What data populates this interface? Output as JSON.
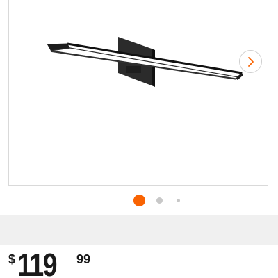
{
  "gallery": {
    "product_image_icon": "vanity-light-bar-image",
    "next_icon": "chevron-right-icon",
    "dots": [
      {
        "state": "active",
        "color": "#f96302"
      },
      {
        "state": "inactive",
        "color": "#c8c8c8"
      },
      {
        "state": "inactive",
        "color": "#c8c8c8"
      }
    ],
    "current_slide": 1
  },
  "price": {
    "currency_symbol": "$",
    "dollars": "119",
    "cents": "99"
  },
  "colors": {
    "accent": "#f96302",
    "band": "#f0f0f0",
    "text": "#1a1a1a"
  }
}
